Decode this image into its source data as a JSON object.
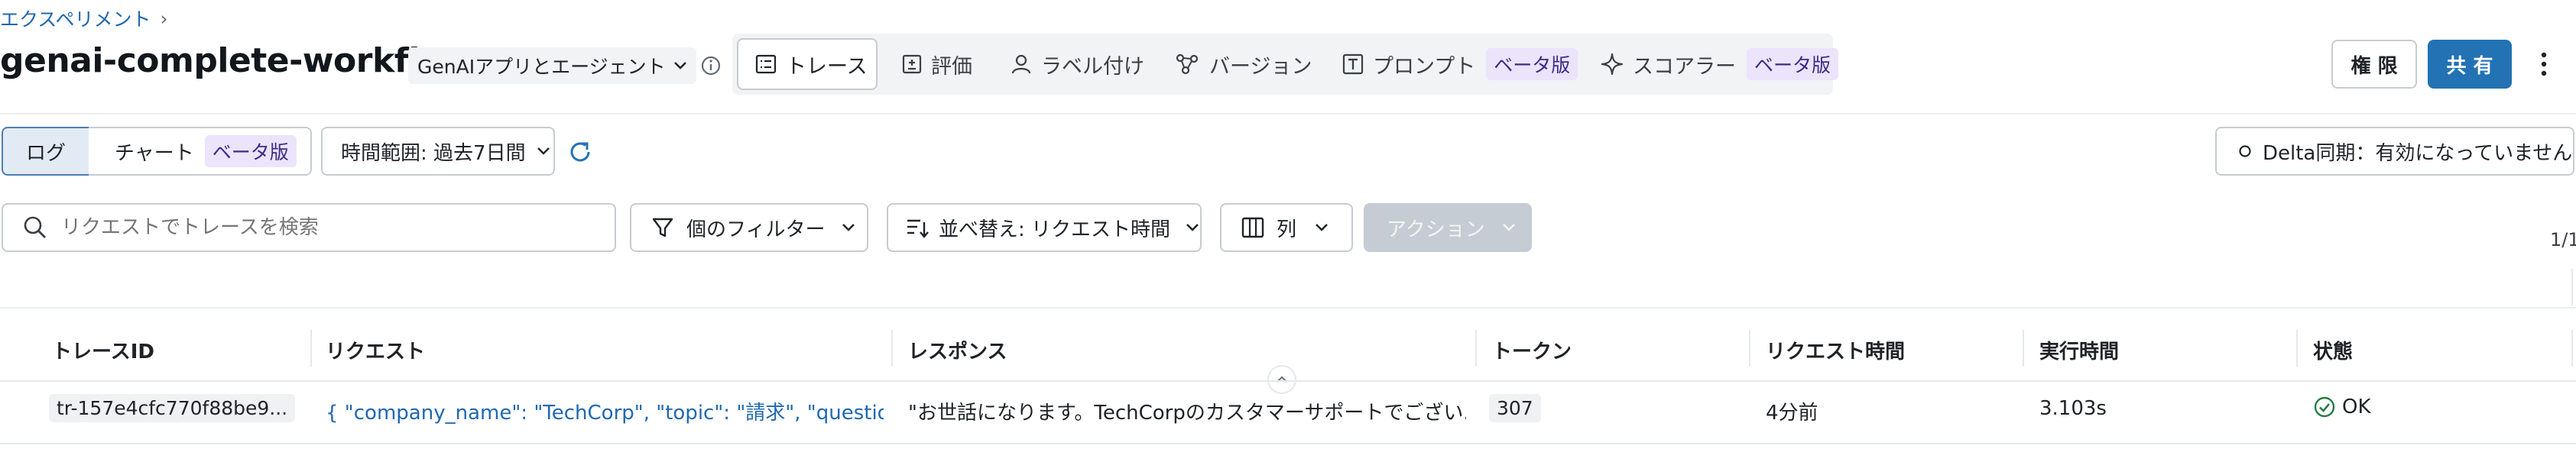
{
  "breadcrumb": {
    "label": "エクスペリメント",
    "separator": "›"
  },
  "experiment": {
    "name": "genai-complete-workfl..."
  },
  "app_type": {
    "label": "GenAIアプリとエージェント"
  },
  "tabs": [
    {
      "label": "トレース",
      "icon": "list-icon",
      "active": true
    },
    {
      "label": "評価",
      "icon": "clipboard-icon"
    },
    {
      "label": "ラベル付け",
      "icon": "user-icon"
    },
    {
      "label": "バージョン",
      "icon": "nodes-icon"
    },
    {
      "label": "プロンプト",
      "icon": "text-box-icon",
      "badge": "ベータ版"
    },
    {
      "label": "スコアラー",
      "icon": "sparkle-icon",
      "badge": "ベータ版"
    }
  ],
  "header_actions": {
    "permissions": "権 限",
    "share": "共 有"
  },
  "view_toggle": {
    "log": "ログ",
    "chart": "チャート",
    "chart_badge": "ベータ版"
  },
  "time_range": {
    "label": "時間範囲: 過去7日間"
  },
  "delta_sync": {
    "label": "Delta同期：有効になっていません"
  },
  "search": {
    "placeholder": "リクエストでトレースを検索"
  },
  "toolbar": {
    "filter": "個のフィルター",
    "sort": "並べ替え: リクエスト時間",
    "columns": "列",
    "actions": "アクション"
  },
  "pagination": {
    "label": "1/1"
  },
  "table": {
    "columns": [
      "トレースID",
      "リクエスト",
      "レスポンス",
      "トークン",
      "リクエスト時間",
      "実行時間",
      "状態"
    ],
    "rows": [
      {
        "trace_id": "tr-157e4cfc770f88be9...",
        "request": "{ \"company_name\": \"TechCorp\", \"topic\": \"請求\", \"question...",
        "response": "\"お世話になります。TechCorpのカスタマーサポートでござい...",
        "tokens": "307",
        "request_time": "4分前",
        "duration": "3.103s",
        "status": "OK"
      }
    ]
  },
  "colors": {
    "primary": "#2272b4",
    "link": "#2068b0",
    "success": "#277c43",
    "beta_bg": "#ebe4fb",
    "disabled": "#c6ccd3"
  }
}
